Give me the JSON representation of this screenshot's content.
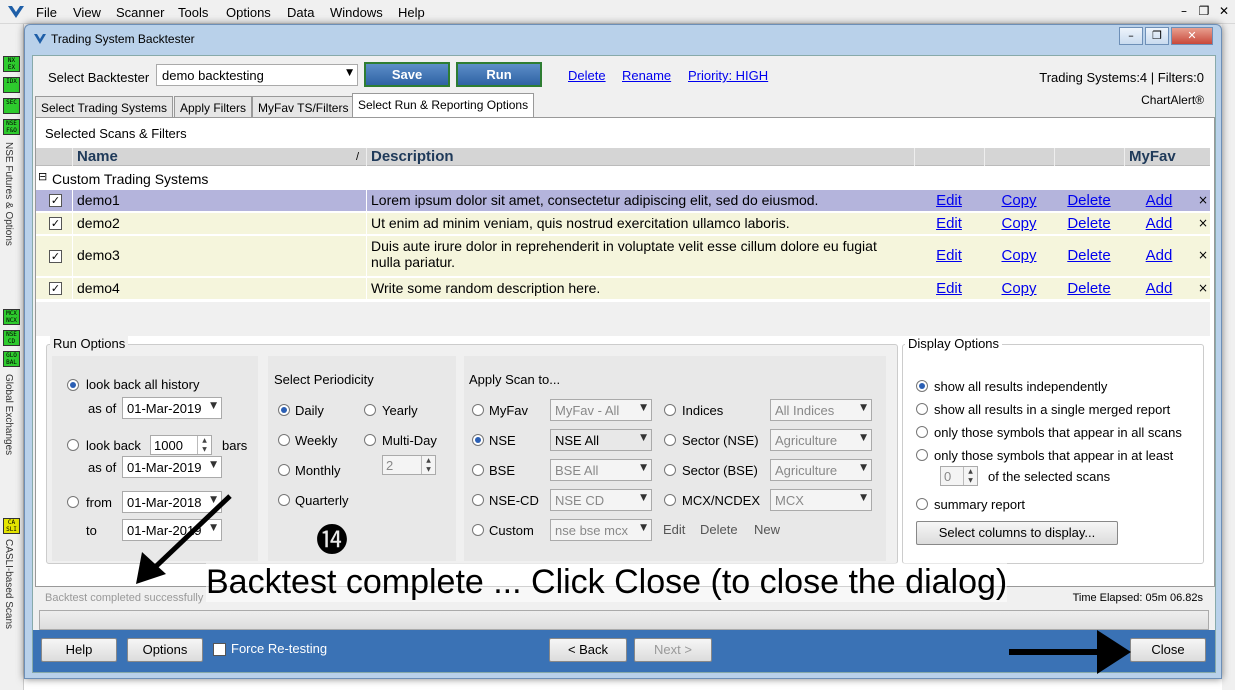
{
  "menu": [
    "File",
    "View",
    "Scanner",
    "Tools",
    "Options",
    "Data",
    "Windows",
    "Help"
  ],
  "window_controls": {
    "minimize": "–",
    "restore": "❐",
    "close": "✕"
  },
  "left_sidebar": {
    "icons": [
      "NX EX",
      "IDX",
      "SEC",
      "NSE F&O",
      "MCX NCX",
      "NSE CD",
      "GLO BAL",
      "CA SLI"
    ],
    "labels": [
      "NSE Futures & Options",
      "Global Exchanges",
      "CASLI-based Scans"
    ]
  },
  "dialog": {
    "title": "Trading System Backtester",
    "select_backtester_label": "Select Backtester",
    "backtester_value": "demo backtesting",
    "save_label": "Save",
    "run_label": "Run",
    "links": {
      "delete": "Delete",
      "rename": "Rename",
      "priority": "Priority: HIGH"
    },
    "summary": "Trading Systems:4 | Filters:0",
    "brand": "ChartAlert®",
    "tabs": [
      "Select Trading Systems",
      "Apply Filters",
      "MyFav TS/Filters",
      "Select Run & Reporting Options"
    ],
    "selected_label": "Selected Scans & Filters",
    "grid": {
      "headers": {
        "name": "Name",
        "sort": "/",
        "description": "Description",
        "myfav": "MyFav"
      },
      "group": "Custom Trading Systems",
      "group_toggle": "⊟",
      "rows": [
        {
          "name": "demo1",
          "description": "Lorem ipsum dolor sit amet, consectetur adipiscing elit, sed do eiusmod.",
          "edit": "Edit",
          "copy": "Copy",
          "delete": "Delete",
          "add": "Add",
          "remove": "×"
        },
        {
          "name": "demo2",
          "description": "Ut enim ad minim veniam, quis nostrud exercitation ullamco laboris.",
          "edit": "Edit",
          "copy": "Copy",
          "delete": "Delete",
          "add": "Add",
          "remove": "×"
        },
        {
          "name": "demo3",
          "description": "Duis aute irure dolor in reprehenderit in voluptate velit esse cillum dolore eu fugiat nulla pariatur.",
          "edit": "Edit",
          "copy": "Copy",
          "delete": "Delete",
          "add": "Add",
          "remove": "×"
        },
        {
          "name": "demo4",
          "description": "Write some random description here.",
          "edit": "Edit",
          "copy": "Copy",
          "delete": "Delete",
          "add": "Add",
          "remove": "×"
        }
      ]
    },
    "run_options": {
      "title": "Run Options",
      "lookback_all": "look back all history",
      "as_of": "as of",
      "date1": "01-Mar-2019",
      "lookback": "look back",
      "bars_value": "1000",
      "bars": "bars",
      "date2": "01-Mar-2019",
      "from": "from",
      "from_date": "01-Mar-2018",
      "to": "to",
      "to_date": "01-Mar-2019"
    },
    "periodicity": {
      "title": "Select Periodicity",
      "daily": "Daily",
      "yearly": "Yearly",
      "weekly": "Weekly",
      "multiday": "Multi-Day",
      "multiday_value": "2",
      "monthly": "Monthly",
      "quarterly": "Quarterly"
    },
    "apply_scan": {
      "title": "Apply Scan to...",
      "myfav": "MyFav",
      "myfav_value": "MyFav - All",
      "nse": "NSE",
      "nse_value": "NSE All",
      "bse": "BSE",
      "bse_value": "BSE All",
      "nsecd": "NSE-CD",
      "nsecd_value": "NSE CD",
      "custom": "Custom",
      "custom_value": "nse bse mcx",
      "indices": "Indices",
      "indices_value": "All Indices",
      "sector_nse": "Sector (NSE)",
      "sector_nse_value": "Agriculture",
      "sector_bse": "Sector (BSE)",
      "sector_bse_value": "Agriculture",
      "mcx": "MCX/NCDEX",
      "mcx_value": "MCX",
      "edit": "Edit",
      "delete": "Delete",
      "new": "New"
    },
    "display_options": {
      "title": "Display Options",
      "opt1": "show all results independently",
      "opt2": "show all results in a single merged report",
      "opt3": "only those symbols that appear in all scans",
      "opt4": "only those symbols that appear in at least",
      "atleast_value": "0",
      "opt4b": "of the selected scans",
      "opt5": "summary report",
      "columns_button": "Select columns to display..."
    },
    "status": "Backtest completed successfully",
    "elapsed": "Time Elapsed: 05m 06.82s",
    "bottom": {
      "help": "Help",
      "options": "Options",
      "force": "Force Re-testing",
      "back": "< Back",
      "next": "Next >",
      "close": "Close"
    }
  },
  "annotation": {
    "step": "⓮",
    "caption": "Backtest complete ... Click Close (to close the dialog)"
  }
}
